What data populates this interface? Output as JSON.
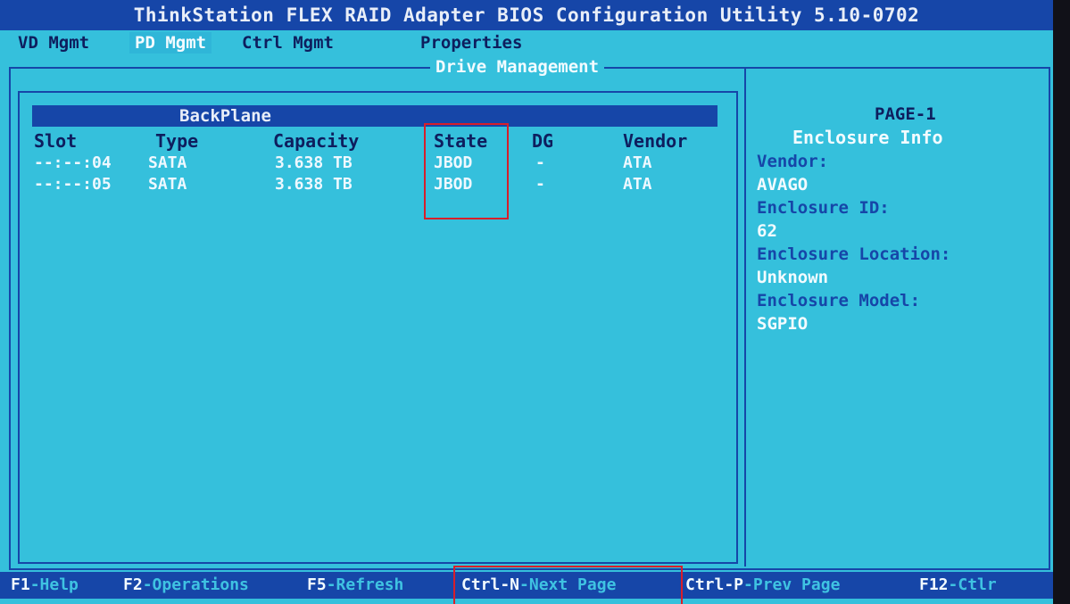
{
  "window": {
    "title": "ThinkStation FLEX RAID Adapter BIOS Configuration Utility 5.10-0702"
  },
  "menu": [
    {
      "label": "VD Mgmt",
      "active": false
    },
    {
      "label": "PD Mgmt",
      "active": true
    },
    {
      "label": "Ctrl Mgmt",
      "active": false
    },
    {
      "label": "Properties",
      "active": false
    }
  ],
  "section_title": "Drive Management",
  "backplane": {
    "header": "BackPlane",
    "columns": [
      "Slot",
      "Type",
      "Capacity",
      "State",
      "DG",
      "Vendor"
    ],
    "rows": [
      {
        "slot": "--:--:04",
        "type": "SATA",
        "capacity": "3.638 TB",
        "state": "JBOD",
        "dg": "-",
        "vendor": "ATA"
      },
      {
        "slot": "--:--:05",
        "type": "SATA",
        "capacity": "3.638 TB",
        "state": "JBOD",
        "dg": "-",
        "vendor": "ATA"
      }
    ]
  },
  "info_panel": {
    "page": "PAGE-1",
    "title": "Enclosure Info",
    "fields": [
      {
        "label": "Vendor:",
        "value": "AVAGO"
      },
      {
        "label": "Enclosure ID:",
        "value": "62"
      },
      {
        "label": "Enclosure Location:",
        "value": "Unknown"
      },
      {
        "label": "Enclosure Model:",
        "value": "SGPIO"
      }
    ]
  },
  "footer": [
    {
      "key": "F1",
      "text": "-Help"
    },
    {
      "key": "F2",
      "text": "-Operations"
    },
    {
      "key": "F5",
      "text": "-Refresh"
    },
    {
      "key": "Ctrl-N",
      "text": "-Next Page"
    },
    {
      "key": "Ctrl-P",
      "text": "-Prev Page"
    },
    {
      "key": "F12",
      "text": "-Ctlr"
    }
  ],
  "colors": {
    "background": "#35c0dc",
    "bar": "#1646a8",
    "highlight": "#d81e2a"
  }
}
